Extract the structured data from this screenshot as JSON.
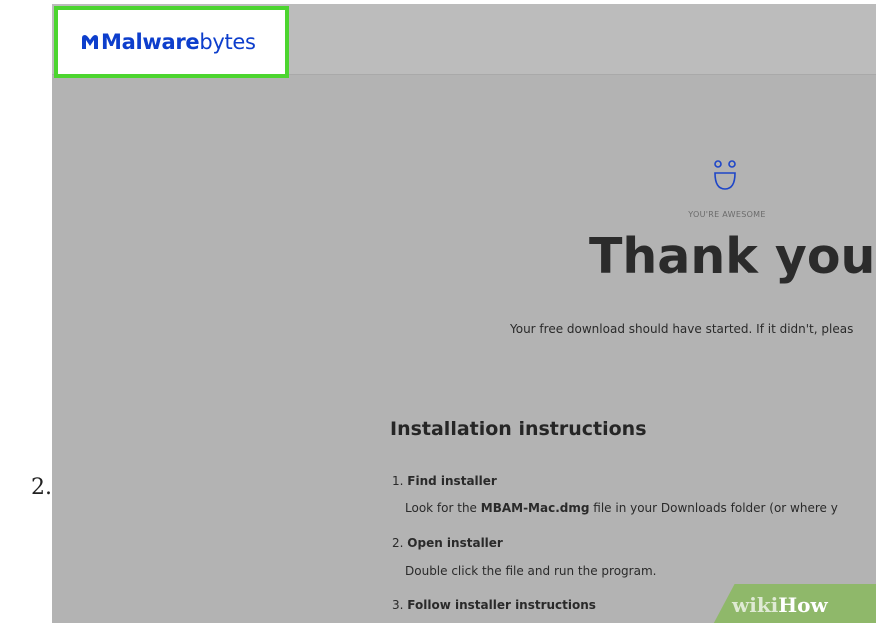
{
  "step_number": "2.",
  "header": {
    "logo_bold": "Malware",
    "logo_light": "bytes",
    "brand_color": "#0d3ecc",
    "highlight_color": "#4cd52f"
  },
  "hero": {
    "eyebrow": "YOU'RE AWESOME",
    "title": "Thank you!",
    "download_message": "Your free download should have started. If it didn't, pleas"
  },
  "instructions": {
    "title": "Installation instructions",
    "steps": [
      {
        "number": "1.",
        "title": "Find installer",
        "desc_before": "Look for the ",
        "desc_bold": "MBAM-Mac.dmg",
        "desc_after": " file in your Downloads folder (or where y"
      },
      {
        "number": "2.",
        "title": "Open installer",
        "desc": "Double click the file and run the program."
      },
      {
        "number": "3.",
        "title": "Follow installer instructions"
      }
    ]
  },
  "watermark": {
    "wiki": "wiki",
    "how": "How"
  }
}
